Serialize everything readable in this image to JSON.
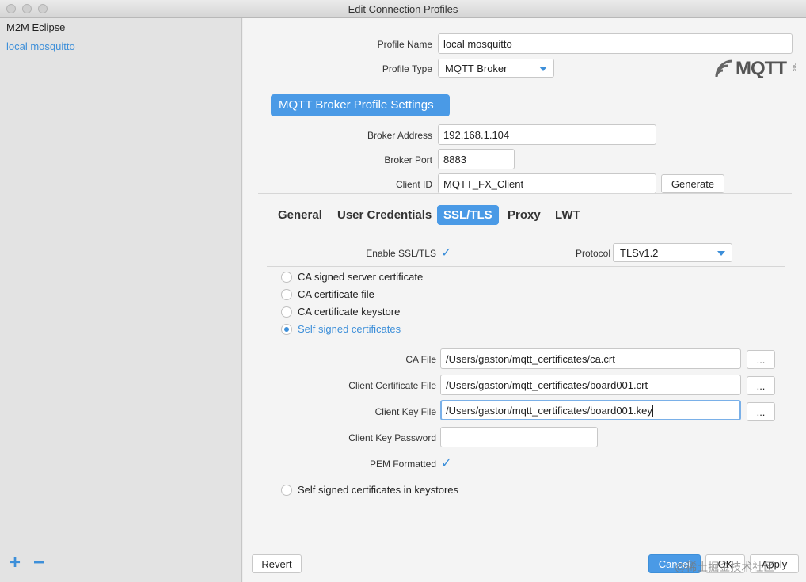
{
  "window": {
    "title": "Edit Connection Profiles"
  },
  "sidebar": {
    "items": [
      {
        "label": "M2M Eclipse",
        "selected": false
      },
      {
        "label": "local mosquitto",
        "selected": true
      }
    ],
    "add_symbol": "+",
    "remove_symbol": "−"
  },
  "profile": {
    "name_label": "Profile Name",
    "name_value": "local mosquitto",
    "type_label": "Profile Type",
    "type_value": "MQTT Broker",
    "logo_text": "MQTT",
    "logo_suffix": "ORG"
  },
  "broker": {
    "section_title": "MQTT Broker Profile Settings",
    "address_label": "Broker Address",
    "address_value": "192.168.1.104",
    "port_label": "Broker Port",
    "port_value": "8883",
    "client_id_label": "Client ID",
    "client_id_value": "MQTT_FX_Client",
    "generate_label": "Generate"
  },
  "tabs": [
    {
      "label": "General",
      "active": false
    },
    {
      "label": "User Credentials",
      "active": false
    },
    {
      "label": "SSL/TLS",
      "active": true
    },
    {
      "label": "Proxy",
      "active": false
    },
    {
      "label": "LWT",
      "active": false
    }
  ],
  "ssl": {
    "enable_label": "Enable SSL/TLS",
    "enable_checked": true,
    "protocol_label": "Protocol",
    "protocol_value": "TLSv1.2",
    "options": [
      {
        "label": "CA signed server certificate",
        "selected": false
      },
      {
        "label": "CA certificate file",
        "selected": false
      },
      {
        "label": "CA certificate keystore",
        "selected": false
      },
      {
        "label": "Self signed certificates",
        "selected": true
      }
    ],
    "ca_file_label": "CA File",
    "ca_file_value": "/Users/gaston/mqtt_certificates/ca.crt",
    "client_cert_label": "Client Certificate File",
    "client_cert_value": "/Users/gaston/mqtt_certificates/board001.crt",
    "client_key_label": "Client Key File",
    "client_key_value": "/Users/gaston/mqtt_certificates/board001.key",
    "client_key_password_label": "Client Key Password",
    "client_key_password_value": "",
    "pem_label": "PEM Formatted",
    "pem_checked": true,
    "keystore_option_label": "Self signed certificates in keystores",
    "browse_label": "..."
  },
  "footer": {
    "revert_label": "Revert",
    "cancel_label": "Cancel",
    "ok_label": "OK",
    "apply_label": "Apply",
    "watermark": "@稀土掘金技术社区"
  },
  "colors": {
    "accent": "#4a9ae6",
    "link": "#3d8fd9",
    "sidebar_bg": "#e3e3e3"
  },
  "icons": {
    "check": "✓"
  }
}
